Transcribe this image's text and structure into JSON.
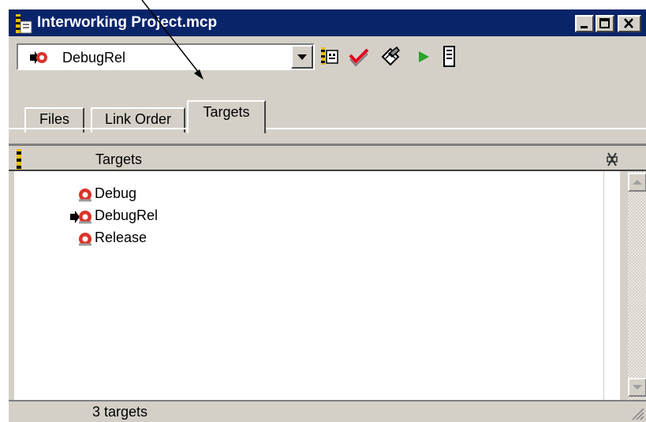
{
  "window": {
    "title": "Interworking Project.mcp",
    "controls": [
      "minimize",
      "maximize",
      "close"
    ]
  },
  "toolbar": {
    "target_select": {
      "value": "DebugRel"
    },
    "buttons": [
      "target-settings-icon",
      "check-syntax-icon",
      "make-icon",
      "run-icon",
      "debug-icon"
    ]
  },
  "tabs": [
    {
      "label": "Files",
      "active": false
    },
    {
      "label": "Link Order",
      "active": false
    },
    {
      "label": "Targets",
      "active": true
    }
  ],
  "list": {
    "header": "Targets",
    "rows": [
      {
        "label": "Debug",
        "current": false
      },
      {
        "label": "DebugRel",
        "current": true
      },
      {
        "label": "Release",
        "current": false
      }
    ]
  },
  "status": {
    "text": "3 targets"
  },
  "colors": {
    "titlebar": "#0a246a",
    "target_icon": "#d9342b",
    "check_icon": "#e6001e",
    "run_icon": "#29a329"
  }
}
